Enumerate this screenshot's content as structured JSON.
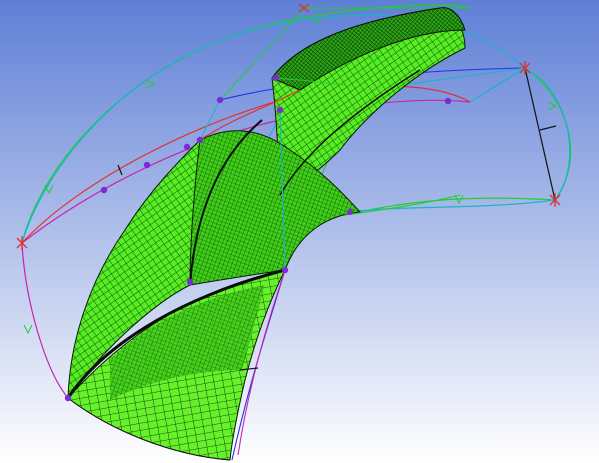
{
  "viewport": {
    "background_top": "#5f7fd6",
    "background_bottom": "#ffffff"
  },
  "model": {
    "mesh_fill": "#55ee22",
    "mesh_line": "#0a1a06",
    "mesh_edge": "#10200a",
    "curve_colors": {
      "green": "#22cc33",
      "cyan": "#19b3cc",
      "red": "#e03030",
      "magenta": "#cc22aa",
      "black": "#111111",
      "blue": "#2030ee"
    },
    "vertex_color": "#7a2bd6",
    "endpoint_marker_color": "#e03030"
  }
}
